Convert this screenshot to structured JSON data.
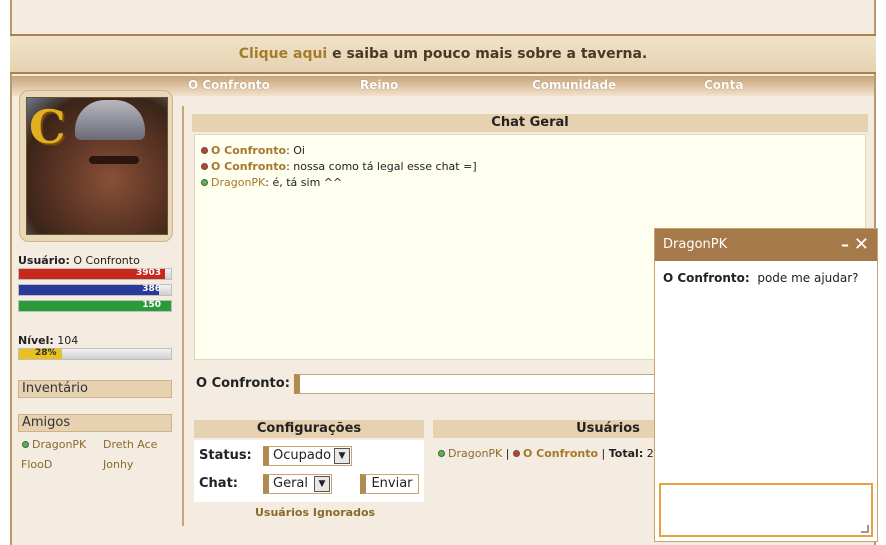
{
  "promo": {
    "link_text": "Clique aqui",
    "text": " e saiba um pouco mais sobre a taverna."
  },
  "nav": [
    "O Confronto",
    "Reino",
    "Comunidade",
    "Conta"
  ],
  "sidebar": {
    "user_label": "Usuário:",
    "user_name": "O Confronto",
    "hp": "3903",
    "mana": "386",
    "stamina": "150",
    "level_label": "Nível:",
    "level": "104",
    "xp": "28%",
    "inventory_title": "Inventário",
    "friends_title": "Amigos",
    "friends": [
      "DragonPK",
      "Dreth Ace",
      "FlooD",
      "Jonhy"
    ]
  },
  "chat": {
    "title": "Chat Geral",
    "messages": [
      {
        "name": "O Confronto",
        "text": ": Oi"
      },
      {
        "name": "O Confronto",
        "text": ": nossa como tá legal esse chat =]"
      },
      {
        "name": "DragonPK",
        "text": ": é, tá sim ^^"
      }
    ],
    "input_label": "O Confronto:"
  },
  "config": {
    "title": "Configurações",
    "status_label": "Status:",
    "status_value": "Ocupado",
    "chat_label": "Chat:",
    "chat_value": "Geral",
    "send_label": "Enviar",
    "ignored_label": "Usuários Ignorados"
  },
  "users": {
    "title": "Usuários",
    "u1": "DragonPK",
    "sep": "|",
    "u2": "O Confronto",
    "total_label": "Total:",
    "total": "2"
  },
  "pm": {
    "title": "DragonPK",
    "min": "–",
    "close": "✕",
    "from": "O Confronto:",
    "text": "pode me ajudar?"
  },
  "colors": {
    "hp": "#c8281c",
    "mana": "#2a3a9a",
    "stamina": "#2a9a3a",
    "xp": "#e8c020",
    "accent": "#a6794a"
  }
}
